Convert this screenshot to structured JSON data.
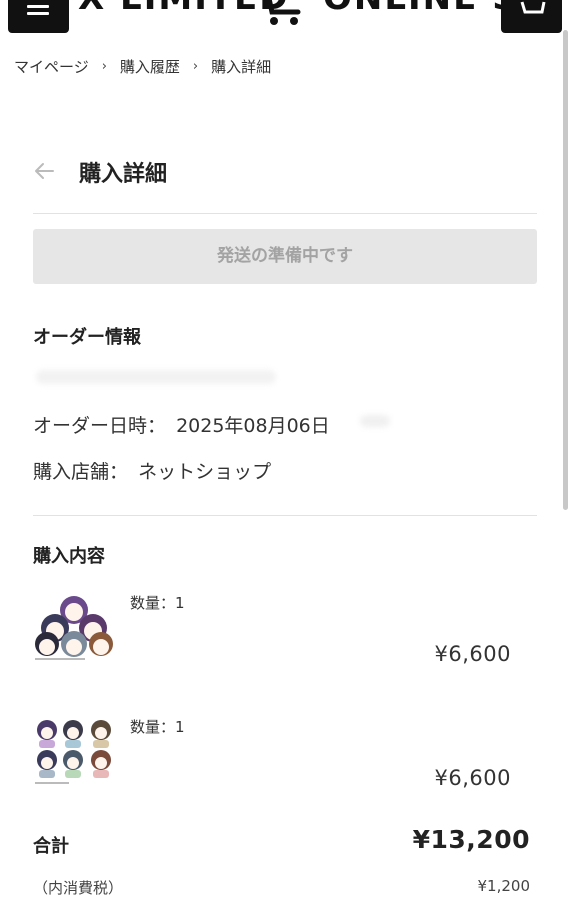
{
  "header": {
    "brand_left": "X LIMITED",
    "brand_right": "ONLINE SH",
    "menu_icon": "hamburger-icon",
    "cart_icon": "cart-icon"
  },
  "breadcrumb": {
    "items": [
      "マイページ",
      "購入履歴",
      "購入詳細"
    ],
    "separator": "›"
  },
  "page": {
    "title": "購入詳細",
    "status": "発送の準備中です"
  },
  "order_info": {
    "heading": "オーダー情報",
    "date_label": "オーダー日時：",
    "date_value": "2025年08月06日",
    "store_label": "購入店舗：",
    "store_value": "ネットショップ"
  },
  "purchase": {
    "heading": "購入内容",
    "items": [
      {
        "qty": "数量：1",
        "price": "¥6,600"
      },
      {
        "qty": "数量：1",
        "price": "¥6,600"
      }
    ]
  },
  "totals": {
    "total_label": "合計",
    "total_value": "¥13,200",
    "tax_label": "（内消費税）",
    "tax_value": "¥1,200"
  },
  "colors": {
    "header_button": "#111111",
    "status_bg": "#e6e6e6",
    "status_text": "#a3a3a3"
  }
}
